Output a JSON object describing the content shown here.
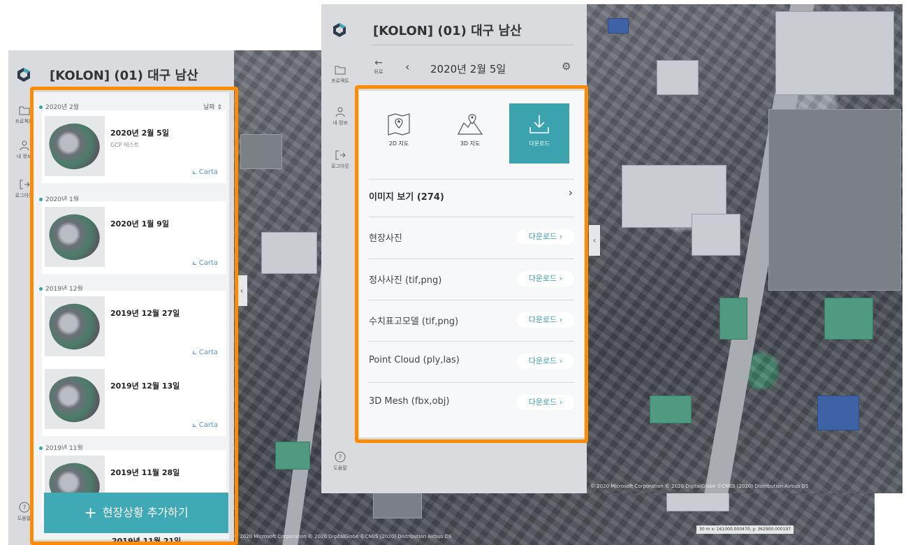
{
  "project_title": "[KOLON] (01) 대구 남산",
  "rail": {
    "projects": "프로젝트",
    "my_info": "내 정보",
    "logout": "로그아웃",
    "help": "도움말"
  },
  "back": {
    "sort_label": "날짜",
    "groups": [
      {
        "month": "2020년 2월",
        "items": [
          {
            "date": "2020년 2월 5일",
            "sub": "GCP 테스트",
            "carta": "Carta"
          }
        ]
      },
      {
        "month": "2020년 1월",
        "items": [
          {
            "date": "2020년 1월 9일",
            "sub": "",
            "carta": "Carta"
          }
        ]
      },
      {
        "month": "2019년 12월",
        "items": [
          {
            "date": "2019년 12월 27일",
            "sub": "",
            "carta": "Carta"
          },
          {
            "date": "2019년 12월 13일",
            "sub": "",
            "carta": "Carta"
          }
        ]
      },
      {
        "month": "2019년 11월",
        "items": [
          {
            "date": "2019년 11월 28일",
            "sub": "",
            "carta": ""
          }
        ]
      }
    ],
    "partial_item": "2019년 11월 21일",
    "add_button": "현장상황 추가하기"
  },
  "front": {
    "back_label": "뒤로",
    "date": "2020년 2월 5일",
    "tiles": [
      {
        "icon": "map-2d-icon",
        "label": "2D 지도",
        "active": false
      },
      {
        "icon": "map-3d-icon",
        "label": "3D 지도",
        "active": false
      },
      {
        "icon": "download-icon",
        "label": "다운로드",
        "active": true
      }
    ],
    "images_row": "이미지 보기 (274)",
    "downloads": [
      {
        "label": "현장사진",
        "button": "다운로드"
      },
      {
        "label": "정사사진 (tif,png)",
        "button": "다운로드"
      },
      {
        "label": "수치표고모델 (tif,png)",
        "button": "다운로드"
      },
      {
        "label": "Point Cloud (ply,las)",
        "button": "다운로드"
      },
      {
        "label": "3D Mesh (fbx,obj)",
        "button": "다운로드"
      }
    ]
  },
  "map": {
    "attribution": "© 2020 Microsoft Corporation © 2020 DigitalGlobe ©CNES (2020) Distribution Airbus DS",
    "scale": "30 m",
    "coords": "x: 161000.000470, y: 362900.000197"
  },
  "colors": {
    "accent": "#3faab6",
    "highlight_frame": "#ff8c00",
    "panel": "#d9dbde"
  }
}
